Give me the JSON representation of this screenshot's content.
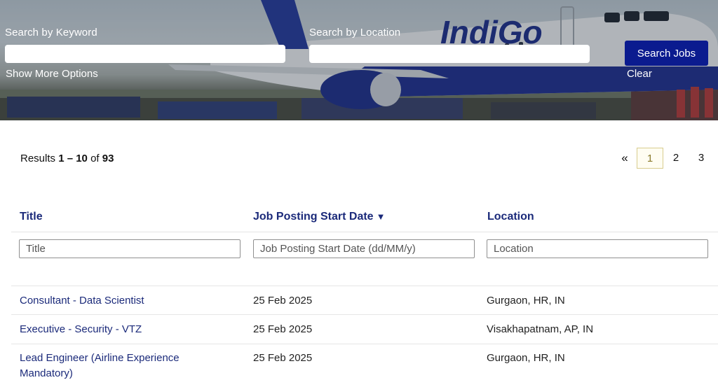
{
  "search": {
    "keyword_label": "Search by Keyword",
    "keyword_value": "",
    "location_label": "Search by Location",
    "location_value": "",
    "search_button": "Search Jobs",
    "more_options": "Show More Options",
    "clear": "Clear"
  },
  "banner": {
    "brand_text": "IndiGo"
  },
  "results": {
    "prefix": "Results ",
    "range": "1 – 10",
    "mid": " of ",
    "total": "93"
  },
  "pagination": {
    "prev": "«",
    "pages": [
      "1",
      "2",
      "3"
    ],
    "current": "1"
  },
  "table": {
    "columns": {
      "title": "Title",
      "date": "Job Posting Start Date",
      "date_sort_icon": "▼",
      "location": "Location"
    },
    "filters": {
      "title_placeholder": "Title",
      "date_placeholder": "Job Posting Start Date (dd/MM/y)",
      "location_placeholder": "Location"
    },
    "rows": [
      {
        "title": "Consultant - Data Scientist",
        "date": "25 Feb 2025",
        "location": "Gurgaon, HR, IN"
      },
      {
        "title": "Executive - Security - VTZ",
        "date": "25 Feb 2025",
        "location": "Visakhapatnam, AP, IN"
      },
      {
        "title": "Lead Engineer (Airline Experience Mandatory)",
        "date": "25 Feb 2025",
        "location": "Gurgaon, HR, IN"
      }
    ]
  },
  "colors": {
    "accent": "#0b1b8f",
    "link": "#1b2a7a"
  }
}
